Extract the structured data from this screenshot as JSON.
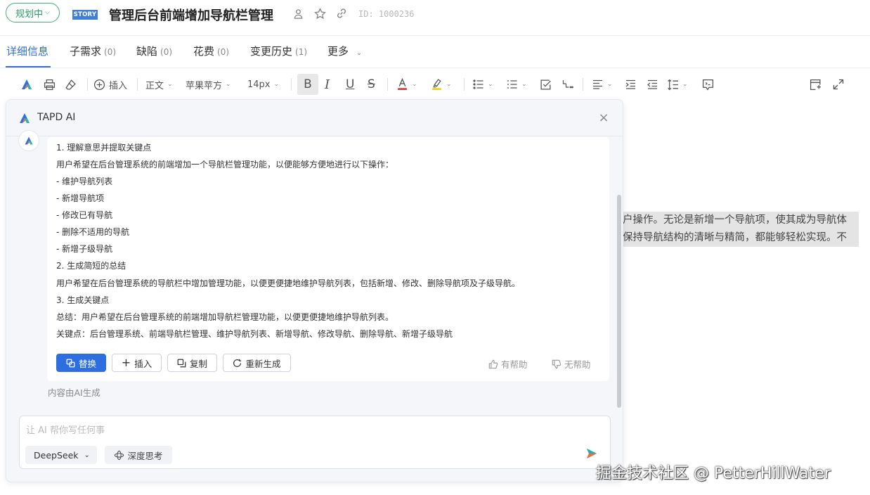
{
  "header": {
    "status": "规划中",
    "badge": "STORY",
    "title": "管理后台前端增加导航栏管理",
    "id_text": "ID: 1000236"
  },
  "tabs": [
    {
      "label": "详细信息",
      "count": ""
    },
    {
      "label": "子需求",
      "count": "(0)"
    },
    {
      "label": "缺陷",
      "count": "(0)"
    },
    {
      "label": "花费",
      "count": "(0)"
    },
    {
      "label": "变更历史",
      "count": "(1)"
    },
    {
      "label": "更多",
      "count": ""
    }
  ],
  "toolbar": {
    "insert": "插入",
    "paragraph": "正文",
    "font": "苹果苹方",
    "size": "14px"
  },
  "doc": {
    "line1": "户操作。无论是新增一个导航项，使其成为导航体",
    "line2": "保持导航结构的清晰与精简，都能够轻松实现。不"
  },
  "ai": {
    "title": "TAPD AI",
    "lines": [
      "1. 理解意思并提取关键点",
      "用户希望在后台管理系统的前端增加一个导航栏管理功能，以便能够方便地进行以下操作：",
      "- 维护导航列表",
      "- 新增导航项",
      "- 修改已有导航",
      "- 删除不适用的导航",
      "- 新增子级导航",
      "2. 生成简短的总结",
      "用户希望在后台管理系统的导航栏中增加管理功能，以便更便捷地维护导航列表，包括新增、修改、删除导航项及子级导航。",
      "3. 生成关键点",
      "总结：用户希望在后台管理系统的前端增加导航栏管理功能，以便更便捷地维护导航列表。",
      "关键点：后台管理系统、前端导航栏管理、维护导航列表、新增导航、修改导航、删除导航、新增子级导航"
    ],
    "buttons": {
      "replace": "替换",
      "insert": "插入",
      "copy": "复制",
      "regenerate": "重新生成"
    },
    "helpful": "有帮助",
    "unhelpful": "无帮助",
    "note": "内容由AI生成",
    "input_placeholder": "让 AI 帮你写任何事",
    "model": "DeepSeek",
    "deep_think": "深度思考"
  },
  "watermark": "掘金技术社区 @ PetterHillWater"
}
